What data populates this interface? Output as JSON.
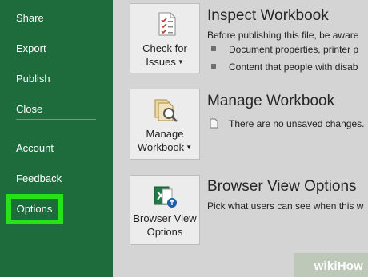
{
  "sidebar": {
    "items": [
      {
        "label": "Share"
      },
      {
        "label": "Export"
      },
      {
        "label": "Publish"
      },
      {
        "label": "Close"
      },
      {
        "label": "Account"
      },
      {
        "label": "Feedback"
      },
      {
        "label": "Options"
      }
    ],
    "bg_color": "#1e6b3c",
    "highlight_color": "#29e11b"
  },
  "sections": {
    "inspect": {
      "tile_line1": "Check for",
      "tile_line2": "Issues",
      "title": "Inspect Workbook",
      "desc": "Before publishing this file, be aware",
      "bullets": [
        "Document properties, printer p",
        "Content that people with disab"
      ],
      "icon": "inspect-document-icon"
    },
    "manage": {
      "tile_line1": "Manage",
      "tile_line2": "Workbook",
      "title": "Manage Workbook",
      "desc": "There are no unsaved changes.",
      "icon": "manage-workbook-icon"
    },
    "browser": {
      "tile_line1": "Browser View",
      "tile_line2": "Options",
      "title": "Browser View Options",
      "desc": "Pick what users can see when this w",
      "icon": "browser-view-icon"
    }
  },
  "watermark": {
    "wiki": "wiki",
    "how": "How"
  }
}
